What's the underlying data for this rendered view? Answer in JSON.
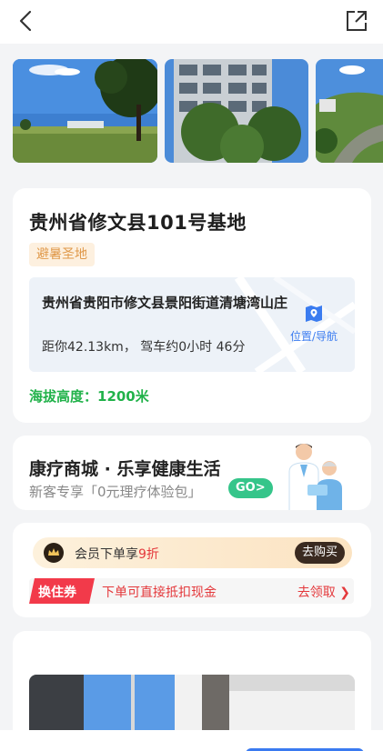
{
  "header": {
    "back_icon": "chevron-left-icon",
    "share_icon": "share-export-icon"
  },
  "gallery": {
    "photos": [
      "grass-field-with-tree",
      "apartment-building",
      "hillside-view"
    ]
  },
  "base": {
    "title": "贵州省修文县101号基地",
    "tag": "避暑圣地",
    "address": "贵州省贵阳市修文县景阳街道清塘湾山庄",
    "distance": "距你42.13km， 驾车约0小时 46分",
    "nav_label": "位置/导航",
    "altitude": "海拔高度：1200米"
  },
  "mall": {
    "title": "康疗商城 · 乐享健康生活",
    "subtitle": "新客专享「0元理疗体验包」",
    "go_label": "GO>"
  },
  "promo": {
    "member_prefix": "会员下单享",
    "member_discount": "9折",
    "buy_label": "去购买",
    "coupon_badge": "换住券",
    "coupon_text": "下单可直接抵扣现金",
    "claim_label": "去领取"
  },
  "colors": {
    "accent_blue": "#3b7cf0",
    "altitude_green": "#21b24a",
    "discount_red": "#e4393c",
    "go_green": "#35c58a",
    "tag_orange": "#e0994a"
  }
}
